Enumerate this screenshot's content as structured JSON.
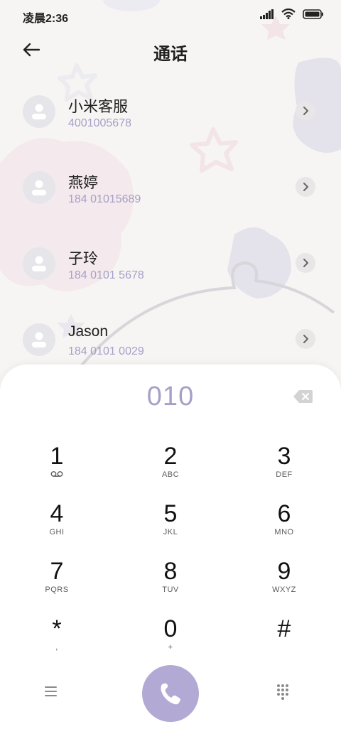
{
  "status_bar": {
    "time": "凌晨2:36"
  },
  "header": {
    "title": "通话"
  },
  "contacts": [
    {
      "name": "小米客服",
      "number": "4001005678"
    },
    {
      "name": "燕婷",
      "number": "184 01015689"
    },
    {
      "name": "子玲",
      "number": "184 0101 5678"
    },
    {
      "name": "Jason",
      "number": "184 0101 0029"
    }
  ],
  "dialer": {
    "input": "010"
  },
  "keypad": [
    {
      "digit": "1",
      "sub": ""
    },
    {
      "digit": "2",
      "sub": "ABC"
    },
    {
      "digit": "3",
      "sub": "DEF"
    },
    {
      "digit": "4",
      "sub": "GHI"
    },
    {
      "digit": "5",
      "sub": "JKL"
    },
    {
      "digit": "6",
      "sub": "MNO"
    },
    {
      "digit": "7",
      "sub": "PQRS"
    },
    {
      "digit": "8",
      "sub": "TUV"
    },
    {
      "digit": "9",
      "sub": "WXYZ"
    },
    {
      "digit": "*",
      "sub": ","
    },
    {
      "digit": "0",
      "sub": "+"
    },
    {
      "digit": "#",
      "sub": ""
    }
  ],
  "icons": {
    "back": "arrow-left-icon",
    "delete": "backspace-icon",
    "menu": "menu-icon",
    "call": "phone-icon",
    "keypad": "dialpad-icon",
    "voicemail": "voicemail-icon"
  },
  "colors": {
    "accent": "#b2a9d4",
    "number_text": "#a79fc8"
  }
}
